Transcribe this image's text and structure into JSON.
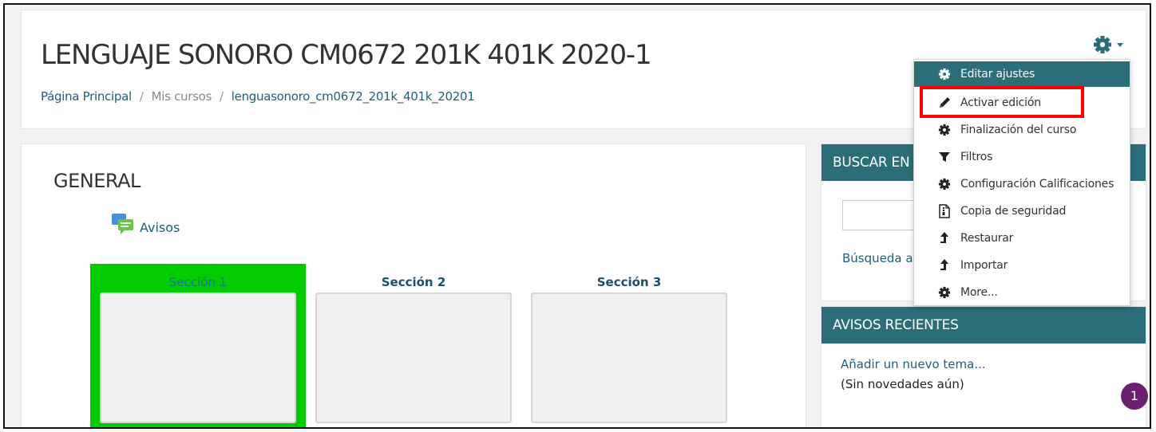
{
  "header": {
    "title": "LENGUAJE SONORO CM0672 201K 401K 2020-1",
    "breadcrumb": [
      "Página Principal",
      "Mis cursos",
      "lenguasonoro_cm0672_201k_401k_20201"
    ]
  },
  "settings_menu": {
    "items": [
      {
        "label": "Editar ajustes",
        "icon": "gear-icon"
      },
      {
        "label": "Activar edición",
        "icon": "pencil-icon"
      },
      {
        "label": "Finalización del curso",
        "icon": "gear-icon"
      },
      {
        "label": "Filtros",
        "icon": "filter-icon"
      },
      {
        "label": "Configuración Calificaciones",
        "icon": "gear-icon"
      },
      {
        "label": "Copia de seguridad",
        "icon": "file-archive-icon"
      },
      {
        "label": "Restaurar",
        "icon": "upload-icon"
      },
      {
        "label": "Importar",
        "icon": "upload-icon"
      },
      {
        "label": "More...",
        "icon": "gear-icon"
      }
    ]
  },
  "main": {
    "section_title": "GENERAL",
    "forum_link": "Avisos",
    "sections": [
      {
        "label": "Sección 1",
        "selected": true
      },
      {
        "label": "Sección 2",
        "selected": false
      },
      {
        "label": "Sección 3",
        "selected": false
      }
    ]
  },
  "search_block": {
    "title": "BUSCAR EN",
    "advanced_link": "Búsqueda av"
  },
  "recent_block": {
    "title": "AVISOS RECIENTES",
    "add_link": "Añadir un nuevo tema...",
    "empty_text": "(Sin novedades aún)"
  },
  "notification_count": "1",
  "colors": {
    "accent": "#2b6e79",
    "link": "#1f5f7a",
    "selected_tile": "#00cc00",
    "highlight": "#ff0000",
    "badge": "#6b1f6e"
  }
}
